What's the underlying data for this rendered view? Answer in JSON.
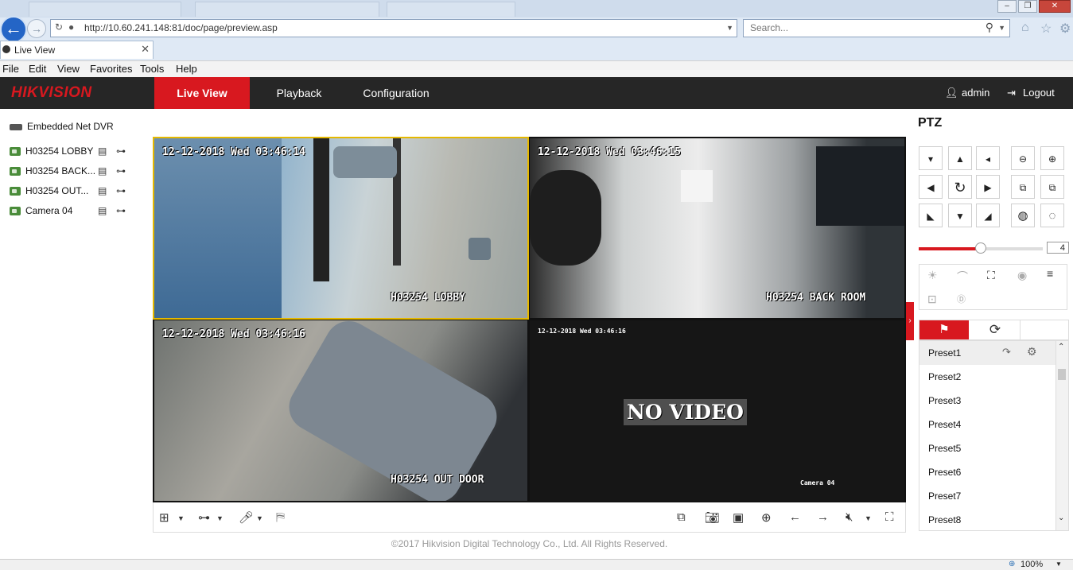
{
  "browser": {
    "tab_title": "Live View",
    "url": "http://10.60.241.148:81/doc/page/preview.asp",
    "search_placeholder": "Search...",
    "menu": [
      "File",
      "Edit",
      "View",
      "Favorites",
      "Tools",
      "Help"
    ],
    "zoom": "100%"
  },
  "header": {
    "brand": "HIKVISION",
    "nav": [
      "Live View",
      "Playback",
      "Configuration"
    ],
    "active_nav": "Live View",
    "user": "admin",
    "logout": "Logout"
  },
  "tree": {
    "device": "Embedded Net DVR",
    "cameras": [
      "H03254 LOBBY",
      "H03254 BACK...",
      "H03254 OUT...",
      "Camera 04"
    ]
  },
  "video": {
    "tiles": [
      {
        "time": "12-12-2018 Wed 03:46:14",
        "name": "H03254 LOBBY"
      },
      {
        "time": "12-12-2018 Wed 03:46:15",
        "name": "H03254 BACK ROOM"
      },
      {
        "time": "12-12-2018 Wed 03:46:16",
        "name": "H03254 OUT DOOR"
      },
      {
        "time": "12-12-2018 Wed 03:46:16",
        "name": "Camera 04",
        "no_video": "NO VIDEO"
      }
    ]
  },
  "ptz": {
    "title": "PTZ",
    "speed": "4",
    "speed_fraction": 0.5,
    "presets": [
      "Preset1",
      "Preset2",
      "Preset3",
      "Preset4",
      "Preset5",
      "Preset6",
      "Preset7",
      "Preset8"
    ]
  },
  "footer": {
    "copyright": "©2017 Hikvision Digital Technology Co., Ltd. All Rights Reserved."
  },
  "colors": {
    "accent": "#d8181f",
    "header_bg": "#262626",
    "selected_border": "#e5b800"
  }
}
